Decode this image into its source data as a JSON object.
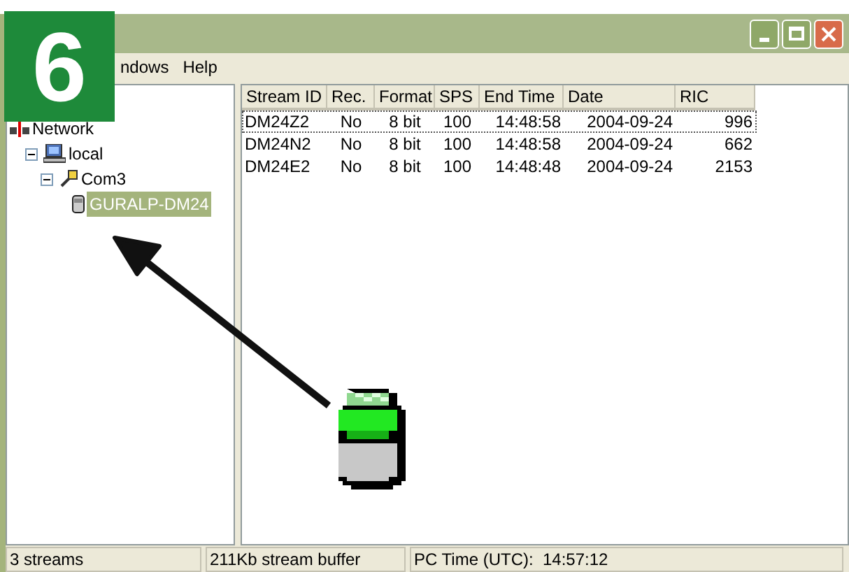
{
  "step_badge": "6",
  "menu": [
    {
      "label": "ndows"
    },
    {
      "label": "Help"
    }
  ],
  "tree": [
    {
      "label": "Network",
      "kind": "network",
      "selected": false,
      "children": [
        {
          "label": "local",
          "kind": "computer",
          "selected": false,
          "expanded": true,
          "children": [
            {
              "label": "Com3",
              "kind": "port",
              "selected": false,
              "expanded": true,
              "children": [
                {
                  "label": "GURALP-DM24",
                  "kind": "digitizer",
                  "selected": true
                }
              ]
            }
          ]
        }
      ]
    }
  ],
  "table": {
    "columns": [
      "Stream ID",
      "Rec.",
      "Format",
      "SPS",
      "End Time",
      "Date",
      "RIC"
    ],
    "rows": [
      {
        "cells": [
          "DM24Z2",
          "No",
          "8 bit",
          "100",
          "14:48:58",
          "2004-09-24",
          "996"
        ],
        "focused": true
      },
      {
        "cells": [
          "DM24N2",
          "No",
          "8 bit",
          "100",
          "14:48:58",
          "2004-09-24",
          "662"
        ],
        "focused": false
      },
      {
        "cells": [
          "DM24E2",
          "No",
          "8 bit",
          "100",
          "14:48:48",
          "2004-09-24",
          "2153"
        ],
        "focused": false
      }
    ]
  },
  "status_bar": [
    "3 streams",
    "211Kb stream buffer",
    "PC Time (UTC):  14:57:12"
  ]
}
